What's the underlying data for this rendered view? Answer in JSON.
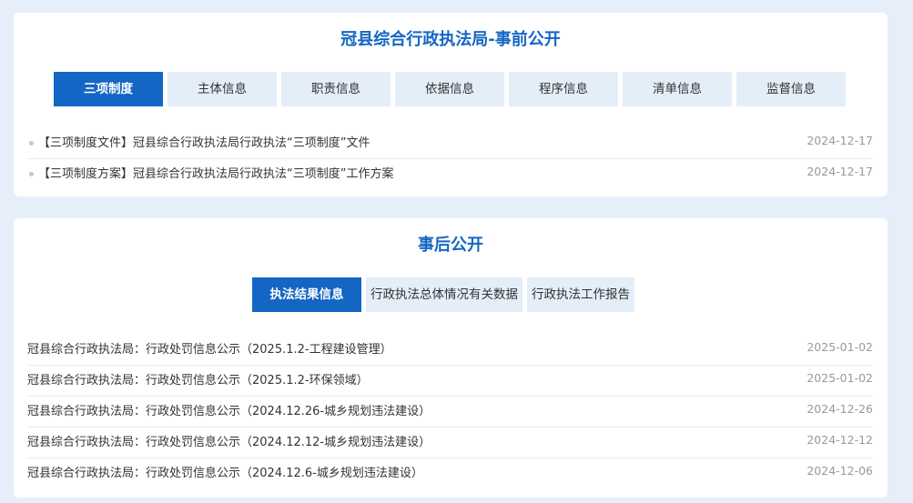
{
  "before": {
    "title": "冠县综合行政执法局-事前公开",
    "tabs": [
      "三项制度",
      "主体信息",
      "职责信息",
      "依据信息",
      "程序信息",
      "清单信息",
      "监督信息"
    ],
    "active_tab": 0,
    "items": [
      {
        "title": "【三项制度文件】冠县综合行政执法局行政执法“三项制度”文件",
        "date": "2024-12-17"
      },
      {
        "title": "【三项制度方案】冠县综合行政执法局行政执法“三项制度”工作方案",
        "date": "2024-12-17"
      }
    ]
  },
  "after": {
    "title": "事后公开",
    "tabs": [
      "执法结果信息",
      "行政执法总体情况有关数据",
      "行政执法工作报告"
    ],
    "active_tab": 0,
    "items": [
      {
        "title": "冠县综合行政执法局：行政处罚信息公示（2025.1.2-工程建设管理）",
        "date": "2025-01-02"
      },
      {
        "title": "冠县综合行政执法局：行政处罚信息公示（2025.1.2-环保领域）",
        "date": "2025-01-02"
      },
      {
        "title": "冠县综合行政执法局：行政处罚信息公示（2024.12.26-城乡规划违法建设）",
        "date": "2024-12-26"
      },
      {
        "title": "冠县综合行政执法局：行政处罚信息公示（2024.12.12-城乡规划违法建设）",
        "date": "2024-12-12"
      },
      {
        "title": "冠县综合行政执法局：行政处罚信息公示（2024.12.6-城乡规划违法建设）",
        "date": "2024-12-06"
      }
    ]
  }
}
